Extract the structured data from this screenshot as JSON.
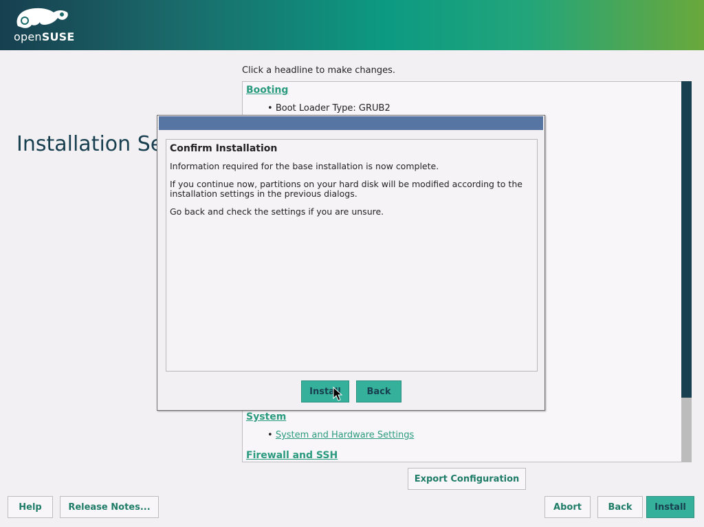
{
  "header": {
    "logo_text_prefix": "open",
    "logo_text_brand": "SUSE"
  },
  "page": {
    "title": "Installation Se",
    "hint": "Click a headline to make changes."
  },
  "summary": {
    "booting": {
      "headline": "Booting",
      "items": [
        "Boot Loader Type: GRUB2"
      ]
    },
    "system": {
      "headline": "System",
      "link": "System and Hardware Settings"
    },
    "firewall": {
      "headline": "Firewall and SSH"
    }
  },
  "export_button": "Export Configuration",
  "bottom_buttons": {
    "help": "Help",
    "release_notes": "Release Notes...",
    "abort": "Abort",
    "back": "Back",
    "install": "Install"
  },
  "dialog": {
    "heading": "Confirm Installation",
    "paragraphs": [
      "Information required for the base installation is now complete.",
      "If you continue now, partitions on your hard disk will be modified according to the installation settings in the previous dialogs.",
      "Go back and check the settings if you are unsure."
    ],
    "install_label": "Install",
    "back_label": "Back"
  },
  "colors": {
    "accent": "#2a9a7f",
    "primary_button": "#35b09a",
    "dialog_titlebar": "#5675a3",
    "dark_teal": "#173f4f"
  }
}
